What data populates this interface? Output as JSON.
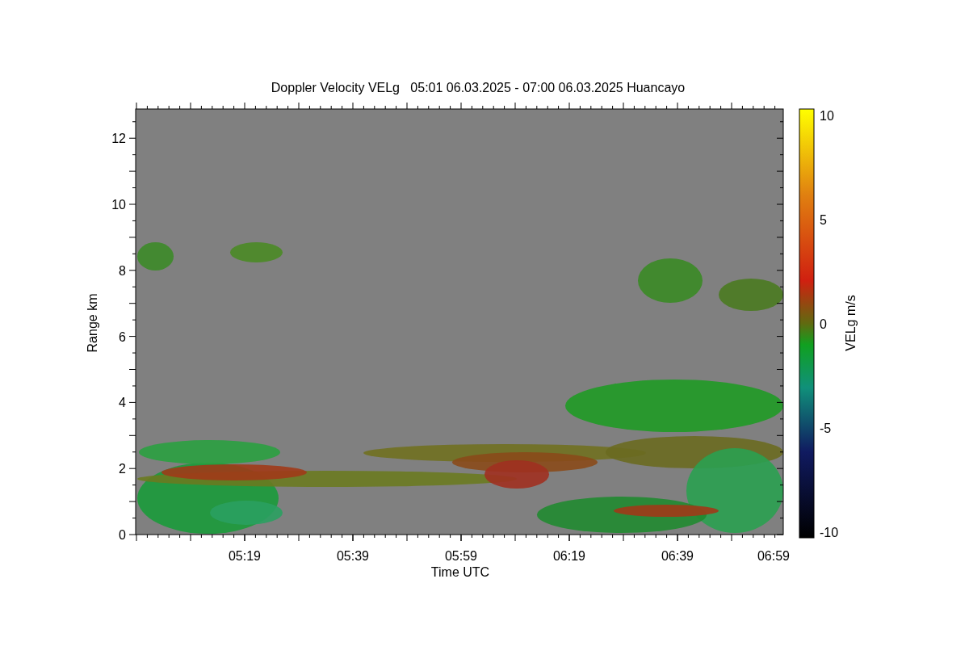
{
  "title": "Doppler Velocity VELg   05:01 06.03.2025 - 07:00 06.03.2025 Huancayo",
  "plot": {
    "xlabel": "Time UTC",
    "ylabel": "Range km",
    "xticks": [
      "05:19",
      "05:39",
      "05:59",
      "06:19",
      "06:39",
      "06:59"
    ],
    "yticks": [
      "12",
      "10",
      "8",
      "6",
      "4",
      "2",
      "0"
    ]
  },
  "colorbar": {
    "label": "VELg m/s",
    "ticks": [
      "10",
      "5",
      "0",
      "-5",
      "-10"
    ]
  }
}
